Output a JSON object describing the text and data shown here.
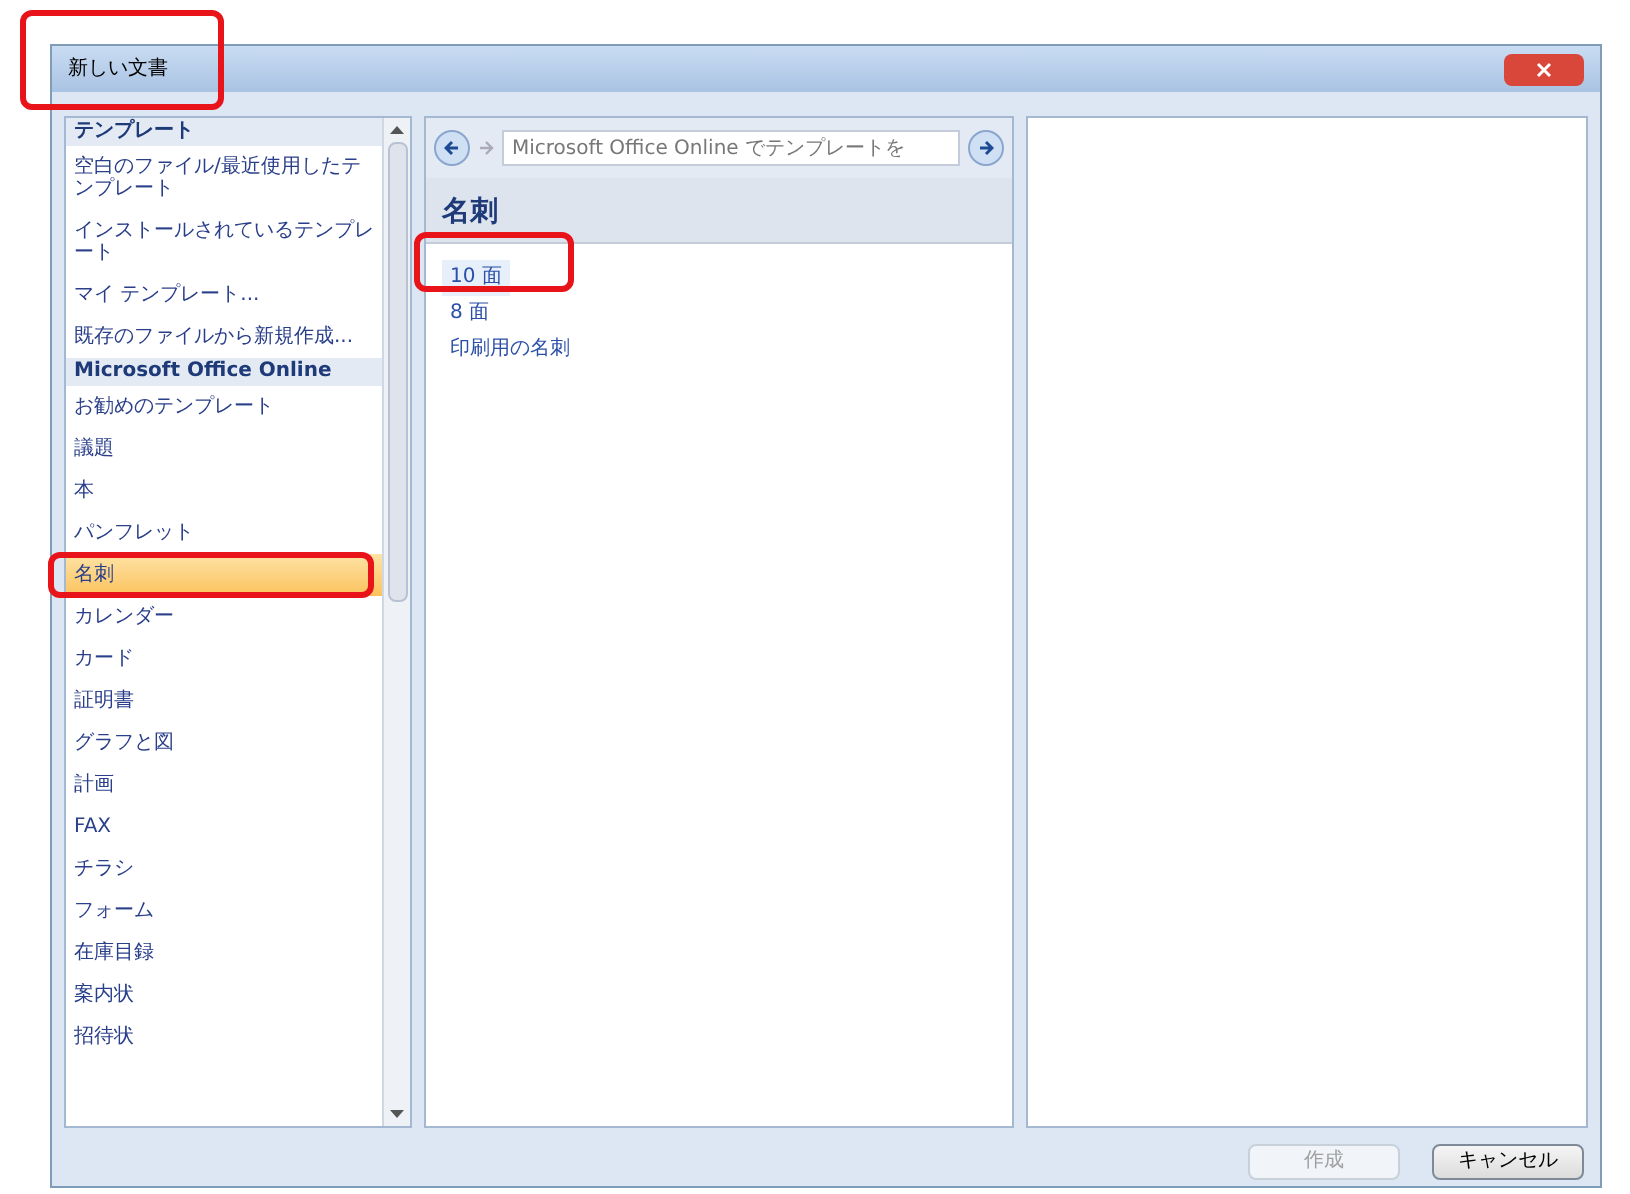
{
  "window": {
    "title": "新しい文書"
  },
  "sidebar": {
    "items": [
      {
        "label": "テンプレート",
        "kind": "header",
        "selected": false
      },
      {
        "label": "空白のファイル/最近使用したテンプレート",
        "kind": "item",
        "selected": false
      },
      {
        "label": "インストールされているテンプレート",
        "kind": "item",
        "selected": false
      },
      {
        "label": "マイ テンプレート...",
        "kind": "item",
        "selected": false
      },
      {
        "label": "既存のファイルから新規作成...",
        "kind": "item",
        "selected": false
      },
      {
        "label": "Microsoft Office Online",
        "kind": "header",
        "selected": false
      },
      {
        "label": "お勧めのテンプレート",
        "kind": "item",
        "selected": false
      },
      {
        "label": "議題",
        "kind": "item",
        "selected": false
      },
      {
        "label": "本",
        "kind": "item",
        "selected": false
      },
      {
        "label": "パンフレット",
        "kind": "item",
        "selected": false
      },
      {
        "label": "名刺",
        "kind": "item",
        "selected": true
      },
      {
        "label": "カレンダー",
        "kind": "item",
        "selected": false
      },
      {
        "label": "カード",
        "kind": "item",
        "selected": false
      },
      {
        "label": "証明書",
        "kind": "item",
        "selected": false
      },
      {
        "label": "グラフと図",
        "kind": "item",
        "selected": false
      },
      {
        "label": "計画",
        "kind": "item",
        "selected": false
      },
      {
        "label": "FAX",
        "kind": "item",
        "selected": false
      },
      {
        "label": "チラシ",
        "kind": "item",
        "selected": false
      },
      {
        "label": "フォーム",
        "kind": "item",
        "selected": false
      },
      {
        "label": "在庫目録",
        "kind": "item",
        "selected": false
      },
      {
        "label": "案内状",
        "kind": "item",
        "selected": false
      },
      {
        "label": "招待状",
        "kind": "item",
        "selected": false
      }
    ]
  },
  "search": {
    "placeholder": "Microsoft Office Online でテンプレートを"
  },
  "category": {
    "title": "名刺",
    "items": [
      {
        "label": "10 面",
        "selected": true
      },
      {
        "label": "8 面",
        "selected": false
      },
      {
        "label": "印刷用の名刺",
        "selected": false
      }
    ]
  },
  "buttons": [
    {
      "label": "作成",
      "disabled": true
    },
    {
      "label": "キャンセル",
      "disabled": false
    }
  ]
}
